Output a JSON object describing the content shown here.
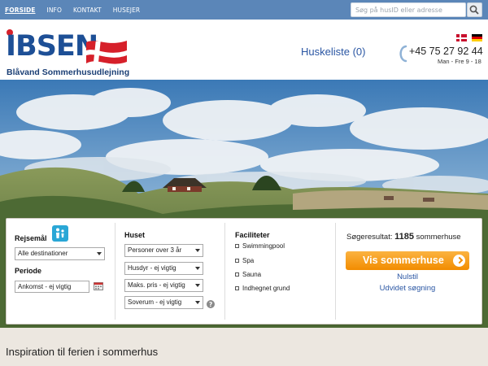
{
  "topnav": {
    "items": [
      {
        "label": "FORSIDE",
        "active": true
      },
      {
        "label": "INFO",
        "active": false
      },
      {
        "label": "KONTAKT",
        "active": false
      },
      {
        "label": "HUSEJER",
        "active": false
      }
    ],
    "search_placeholder": "Søg på husID eller adresse",
    "search_icon": "magnifier-icon"
  },
  "header": {
    "logo_text": "IBSEN",
    "tagline": "Blåvand Sommerhusudlejning",
    "favorites": "Huskeliste (0)",
    "phone": "+45 75 27 92 44",
    "hours": "Man - Fre 9 - 18",
    "languages": [
      "danish-flag-icon",
      "german-flag-icon"
    ]
  },
  "search": {
    "destination_label": "Rejsemål",
    "destination_value": "Alle destinationer",
    "period_label": "Periode",
    "period_value": "Ankomst - ej vigtig",
    "house_label": "Huset",
    "house_selects": [
      "Personer over 3 år",
      "Husdyr - ej vigtig",
      "Maks. pris - ej vigtig",
      "Soverum - ej vigtig"
    ],
    "facilities_label": "Faciliteter",
    "facilities": [
      "Swimmingpool",
      "Spa",
      "Sauna",
      "Indhegnet grund"
    ],
    "result_prefix": "Søgeresultat:",
    "result_count": "1185",
    "result_suffix": "sommerhuse",
    "cta_label": "Vis sommerhuse",
    "reset_label": "Nulstil",
    "advanced_label": "Udvidet søgning"
  },
  "inspiration_heading": "Inspiration til ferien i sommerhus",
  "colors": {
    "topbar": "#5b86b8",
    "brand_blue": "#1d4f96",
    "brand_red": "#d6202a",
    "cta_orange": "#f28c00",
    "link_blue": "#2a56a3"
  }
}
